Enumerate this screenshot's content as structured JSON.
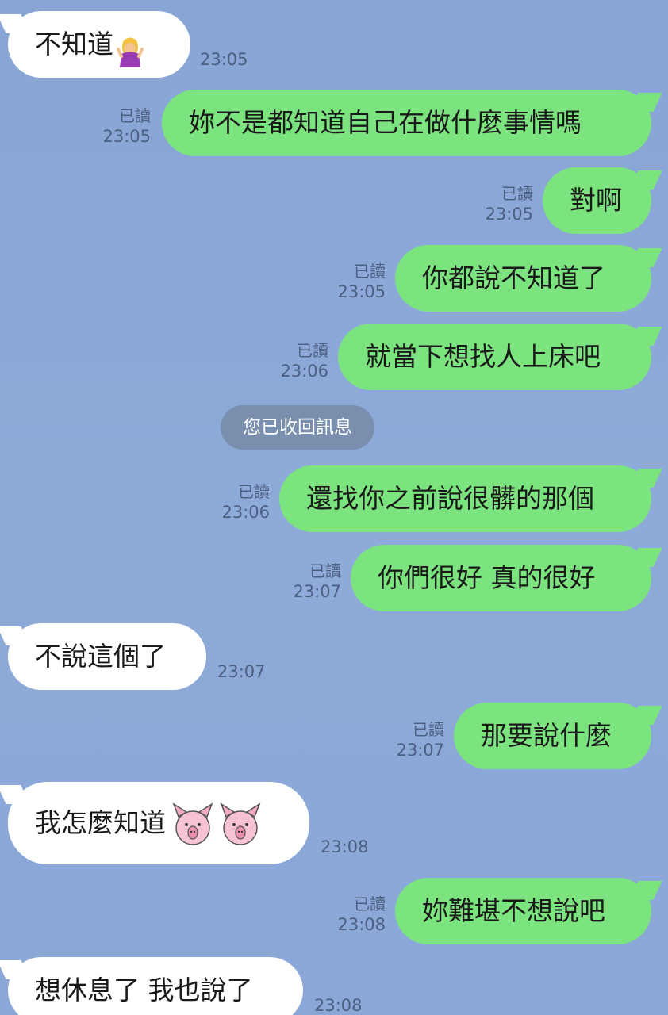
{
  "theme": {
    "background": "#8ba7d6",
    "incoming_bubble": "#ffffff",
    "outgoing_bubble": "#7ce47f",
    "system_bubble": "#7a8fae",
    "meta_text": "#4d5f80"
  },
  "messages": [
    {
      "side": "in",
      "text": "不知道",
      "time": "23:05",
      "emoji": "person-shrugging-icon"
    },
    {
      "side": "out",
      "read": "已讀",
      "text": "妳不是都知道自己在做什麼事情嗎",
      "time": "23:05"
    },
    {
      "side": "out",
      "read": "已讀",
      "text": "對啊",
      "time": "23:05"
    },
    {
      "side": "out",
      "read": "已讀",
      "text": "你都說不知道了",
      "time": "23:05"
    },
    {
      "side": "out",
      "read": "已讀",
      "text": "就當下想找人上床吧",
      "time": "23:06"
    },
    {
      "side": "system",
      "text": "您已收回訊息"
    },
    {
      "side": "out",
      "read": "已讀",
      "text": "還找你之前說很髒的那個",
      "time": "23:06"
    },
    {
      "side": "out",
      "read": "已讀",
      "text": "你們很好 真的很好",
      "time": "23:07"
    },
    {
      "side": "in",
      "text": "不說這個了",
      "time": "23:07"
    },
    {
      "side": "out",
      "read": "已讀",
      "text": "那要說什麼",
      "time": "23:07"
    },
    {
      "side": "in",
      "text": "我怎麼知道",
      "time": "23:08",
      "emoji": "pig-face-icon"
    },
    {
      "side": "out",
      "read": "已讀",
      "text": "妳難堪不想說吧",
      "time": "23:08"
    },
    {
      "side": "in",
      "text": "想休息了 我也說了",
      "time": "23:08"
    }
  ]
}
